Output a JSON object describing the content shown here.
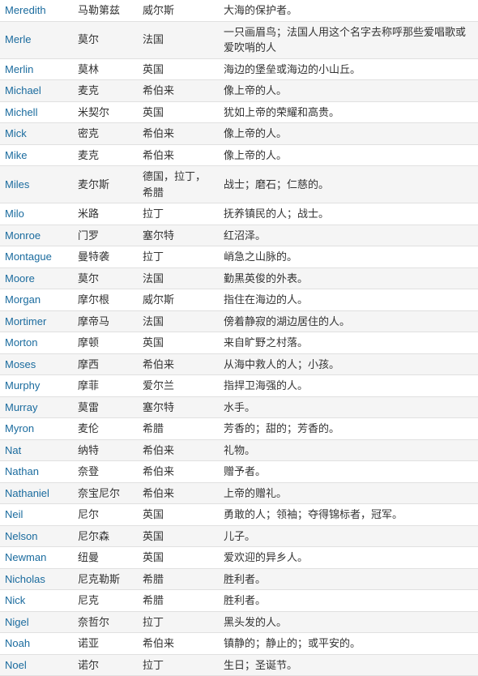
{
  "rows": [
    {
      "name": "Meredith",
      "zh": "马勒第兹",
      "origin": "威尔斯",
      "desc": "大海的保护者。"
    },
    {
      "name": "Merle",
      "zh": "莫尔",
      "origin": "法国",
      "desc": "一只画眉鸟；法国人用这个名字去称呼那些爱唱歌或爱吹哨的人"
    },
    {
      "name": "Merlin",
      "zh": "莫林",
      "origin": "英国",
      "desc": "海边的堡垒或海边的小山丘。"
    },
    {
      "name": "Michael",
      "zh": "麦克",
      "origin": "希伯来",
      "desc": "像上帝的人。"
    },
    {
      "name": "Michell",
      "zh": "米契尔",
      "origin": "英国",
      "desc": "犹如上帝的荣耀和高贵。"
    },
    {
      "name": "Mick",
      "zh": "密克",
      "origin": "希伯来",
      "desc": "像上帝的人。"
    },
    {
      "name": "Mike",
      "zh": "麦克",
      "origin": "希伯来",
      "desc": "像上帝的人。"
    },
    {
      "name": "Miles",
      "zh": "麦尔斯",
      "origin": "德国，拉丁，希腊",
      "desc": "战士；磨石；仁慈的。"
    },
    {
      "name": "Milo",
      "zh": "米路",
      "origin": "拉丁",
      "desc": "抚养镇民的人；战士。"
    },
    {
      "name": "Monroe",
      "zh": "门罗",
      "origin": "塞尔特",
      "desc": "红沼泽。"
    },
    {
      "name": "Montague",
      "zh": "曼特袭",
      "origin": "拉丁",
      "desc": "峭急之山脉的。"
    },
    {
      "name": "Moore",
      "zh": "莫尔",
      "origin": "法国",
      "desc": "勤黑英俊的外表。"
    },
    {
      "name": "Morgan",
      "zh": "摩尔根",
      "origin": "威尔斯",
      "desc": "指住在海边的人。"
    },
    {
      "name": "Mortimer",
      "zh": "摩帝马",
      "origin": "法国",
      "desc": "傍着静寂的湖边居住的人。"
    },
    {
      "name": "Morton",
      "zh": "摩顿",
      "origin": "英国",
      "desc": "来自旷野之村落。"
    },
    {
      "name": "Moses",
      "zh": "摩西",
      "origin": "希伯来",
      "desc": "从海中救人的人；小孩。"
    },
    {
      "name": "Murphy",
      "zh": "摩菲",
      "origin": "爱尔兰",
      "desc": "指捍卫海强的人。"
    },
    {
      "name": "Murray",
      "zh": "莫雷",
      "origin": "塞尔特",
      "desc": "水手。"
    },
    {
      "name": "Myron",
      "zh": "麦伦",
      "origin": "希腊",
      "desc": "芳香的；甜的；芳香的。"
    },
    {
      "name": "Nat",
      "zh": "纳特",
      "origin": "希伯来",
      "desc": "礼物。"
    },
    {
      "name": "Nathan",
      "zh": "奈登",
      "origin": "希伯来",
      "desc": "赠予者。"
    },
    {
      "name": "Nathaniel",
      "zh": "奈宝尼尔",
      "origin": "希伯来",
      "desc": "上帝的赠礼。"
    },
    {
      "name": "Neil",
      "zh": "尼尔",
      "origin": "英国",
      "desc": "勇敢的人；领袖；夺得锦标者，冠军。"
    },
    {
      "name": "Nelson",
      "zh": "尼尔森",
      "origin": "英国",
      "desc": "儿子。"
    },
    {
      "name": "Newman",
      "zh": "纽曼",
      "origin": "英国",
      "desc": "爱欢迎的异乡人。"
    },
    {
      "name": "Nicholas",
      "zh": "尼克勒斯",
      "origin": "希腊",
      "desc": "胜利者。"
    },
    {
      "name": "Nick",
      "zh": "尼克",
      "origin": "希腊",
      "desc": "胜利者。"
    },
    {
      "name": "Nigel",
      "zh": "奈哲尔",
      "origin": "拉丁",
      "desc": "黑头发的人。"
    },
    {
      "name": "Noah",
      "zh": "诺亚",
      "origin": "希伯来",
      "desc": "镇静的；静止的；或平安的。"
    },
    {
      "name": "Noel",
      "zh": "诺尔",
      "origin": "拉丁",
      "desc": "生日；圣诞节。"
    }
  ]
}
